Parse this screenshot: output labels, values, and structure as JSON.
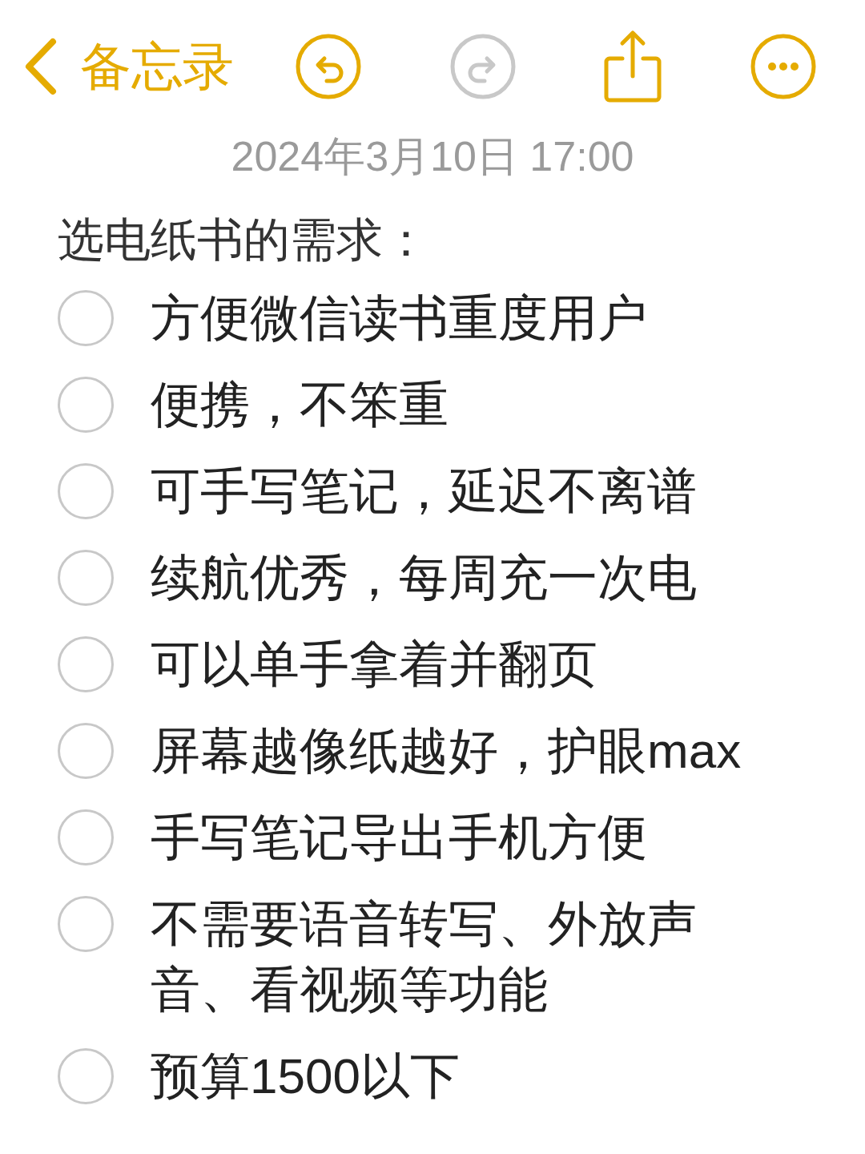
{
  "toolbar": {
    "back_label": "备忘录",
    "buttons": [
      {
        "kind": "undo",
        "disabled": false
      },
      {
        "kind": "redo",
        "disabled": true
      },
      {
        "kind": "share",
        "disabled": false
      },
      {
        "kind": "more",
        "disabled": false
      }
    ]
  },
  "note": {
    "date": "2024年3月10日 17:00",
    "title": "选电纸书的需求：",
    "checklist": [
      {
        "text": "方便微信读书重度用户",
        "checked": false
      },
      {
        "text": "便携，不笨重",
        "checked": false
      },
      {
        "text": "可手写笔记，延迟不离谱",
        "checked": false
      },
      {
        "text": "续航优秀，每周充一次电",
        "checked": false
      },
      {
        "text": "可以单手拿着并翻页",
        "checked": false
      },
      {
        "text": "屏幕越像纸越好，护眼max",
        "checked": false
      },
      {
        "text": "手写笔记导出手机方便",
        "checked": false
      },
      {
        "text": "不需要语音转写、外放声音、看视频等功能",
        "checked": false
      },
      {
        "text": "预算1500以下",
        "checked": false
      }
    ]
  }
}
